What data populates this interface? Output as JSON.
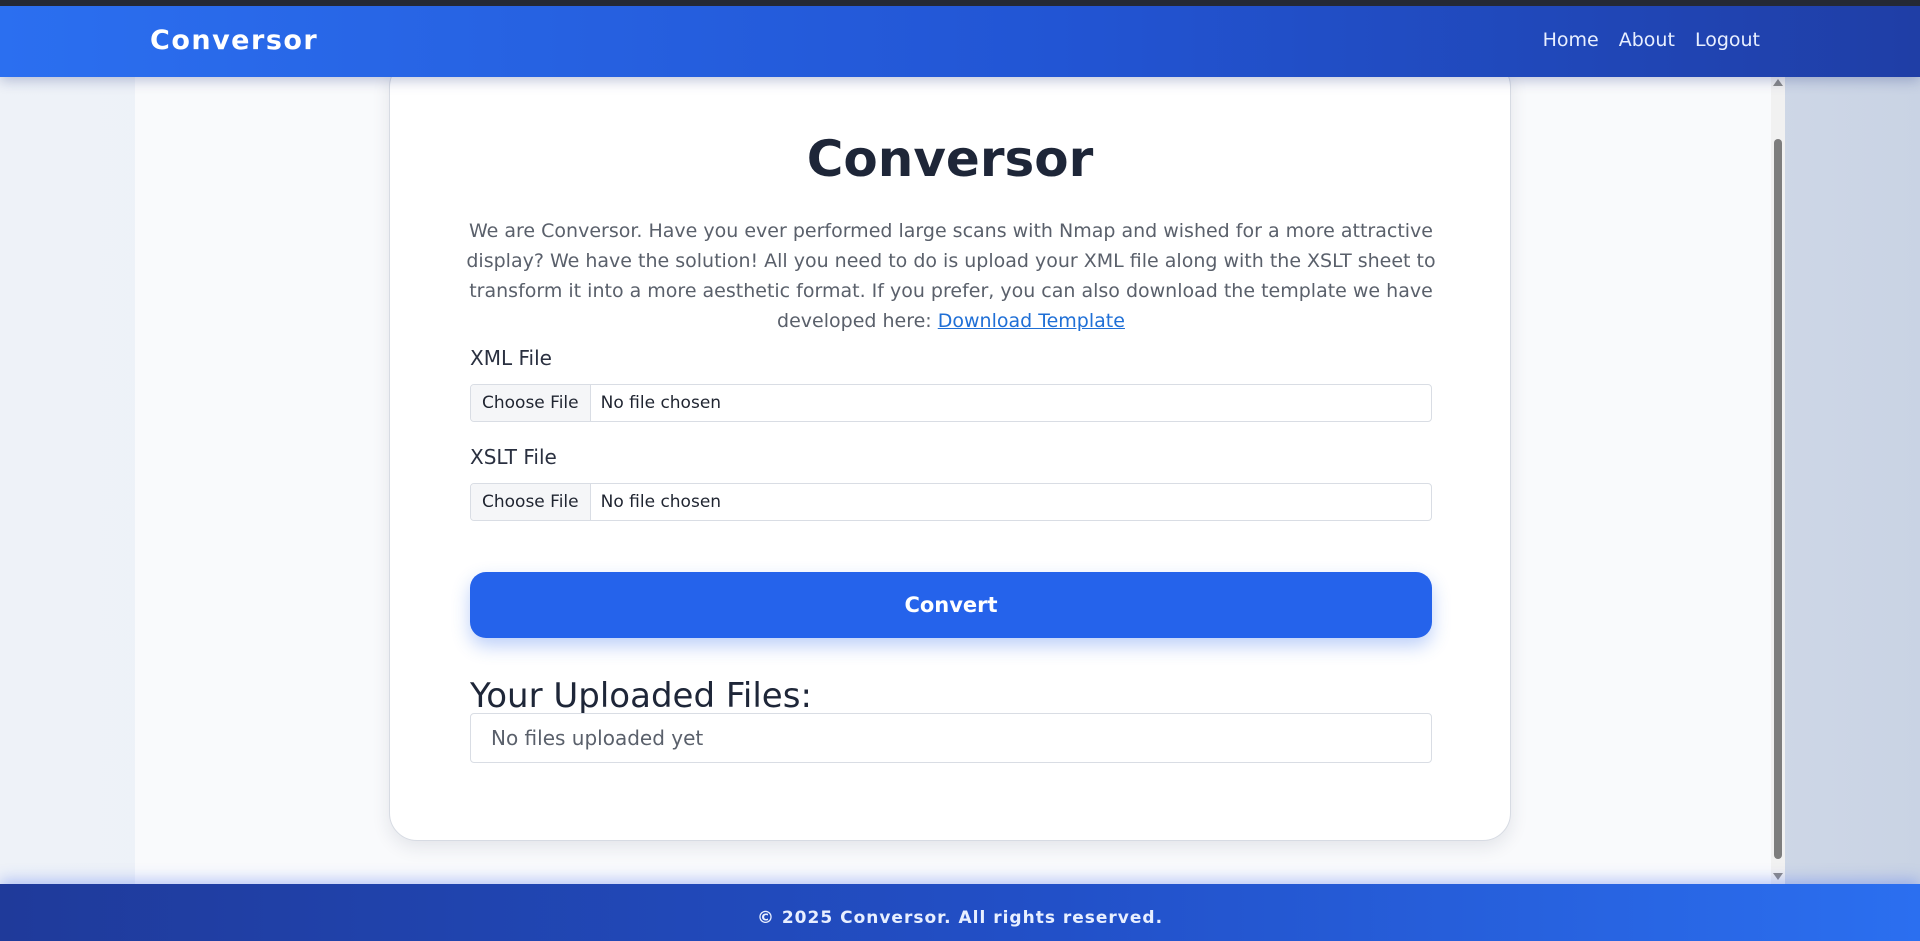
{
  "navbar": {
    "brand": "Conversor",
    "links": [
      "Home",
      "About",
      "Logout"
    ]
  },
  "card": {
    "title": "Conversor",
    "description": "We are Conversor. Have you ever performed large scans with Nmap and wished for a more attractive display? We have the solution! All you need to do is upload your XML file along with the XSLT sheet to transform it into a more aesthetic format. If you prefer, you can also download the template we have developed here: ",
    "download_link": "Download Template",
    "xml_label": "XML File",
    "xslt_label": "XSLT File",
    "file_button": "Choose File",
    "file_status": "No file chosen",
    "convert_label": "Convert",
    "uploaded_heading": "Your Uploaded Files:",
    "uploaded_empty": "No files uploaded yet"
  },
  "footer": {
    "text": "© 2025 Conversor. All rights reserved."
  },
  "colors": {
    "accent": "#2563eb",
    "nav_start": "#2b6ff0",
    "nav_end": "#1f3ea6",
    "link": "#1f6fd6"
  }
}
